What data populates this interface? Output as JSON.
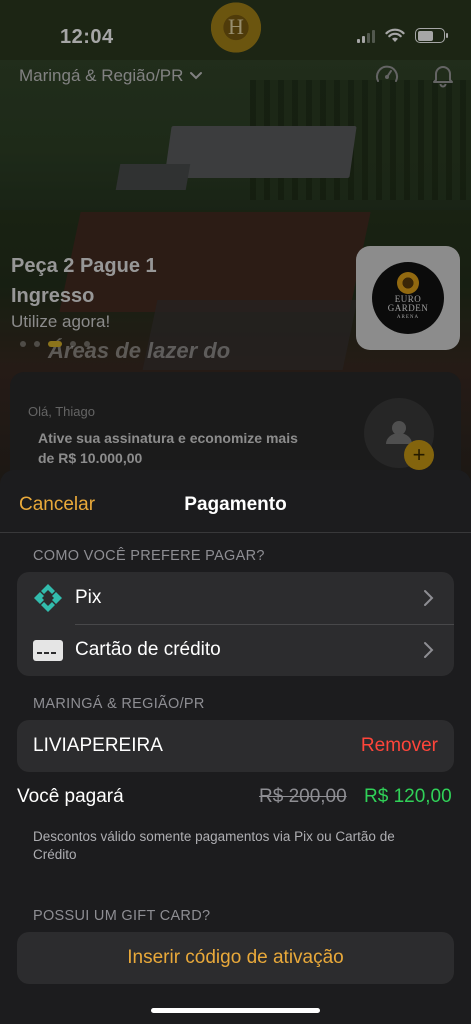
{
  "status_bar": {
    "time": "12:04"
  },
  "header": {
    "location": "Maringá & Região/PR"
  },
  "promo": {
    "title": "Peça 2 Pague 1 Ingresso",
    "subtitle": "Utilize agora!",
    "next_title": "Áreas de lazer do",
    "logo": {
      "line1": "EURO",
      "line2": "GARDEN",
      "line3": "ARENA"
    }
  },
  "subscription": {
    "greeting": "Olá, Thiago",
    "text": "Ative sua assinatura e economize mais de  R$ 10.000,00"
  },
  "sheet": {
    "cancel_label": "Cancelar",
    "title": "Pagamento",
    "payment_section_label": "COMO VOCÊ PREFERE PAGAR?",
    "payment_methods": [
      {
        "label": "Pix",
        "icon": "pix-icon"
      },
      {
        "label": "Cartão de crédito",
        "icon": "credit-card-icon"
      }
    ],
    "coupon_section_label": "MARINGÁ & REGIÃO/PR",
    "coupon": {
      "code": "LIVIAPEREIRA",
      "remove_label": "Remover"
    },
    "total": {
      "label": "Você pagará",
      "old_price": "R$ 200,00",
      "new_price": "R$ 120,00"
    },
    "discount_note": "Descontos válido somente pagamentos via Pix ou Cartão de Crédito",
    "gift_section_label": "POSSUI UM GIFT CARD?",
    "gift_button_label": "Inserir código de ativação"
  },
  "colors": {
    "accent": "#e9a93a",
    "remove": "#ff453a",
    "price_new": "#30d158",
    "sheet_bg": "#1c1c1e",
    "group_bg": "#2c2c2e"
  }
}
